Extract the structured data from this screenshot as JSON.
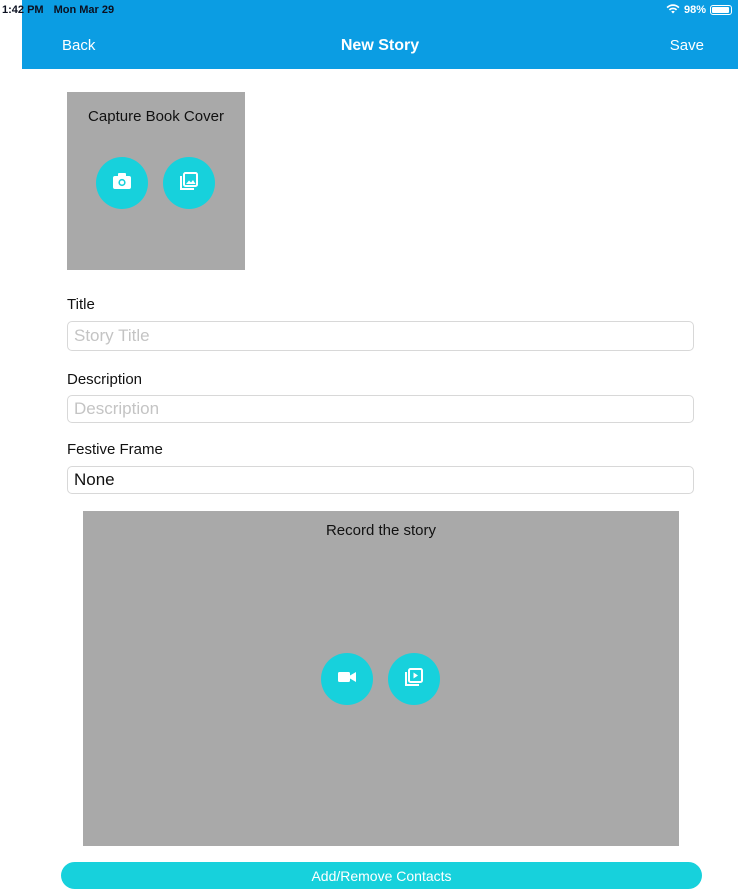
{
  "status_bar": {
    "time": "1:42 PM",
    "date": "Mon Mar 29",
    "battery": "98%"
  },
  "nav": {
    "back_label": "Back",
    "title": "New Story",
    "save_label": "Save"
  },
  "cover": {
    "title": "Capture Book Cover"
  },
  "form": {
    "title_label": "Title",
    "title_placeholder": "Story Title",
    "title_value": "",
    "description_label": "Description",
    "description_placeholder": "Description",
    "description_value": "",
    "frame_label": "Festive Frame",
    "frame_value": "None"
  },
  "record": {
    "title": "Record the story"
  },
  "footer": {
    "contacts_label": "Add/Remove Contacts"
  },
  "colors": {
    "accent": "#0b9de3",
    "button": "#17d1dc",
    "panel": "#a9a9a9"
  }
}
